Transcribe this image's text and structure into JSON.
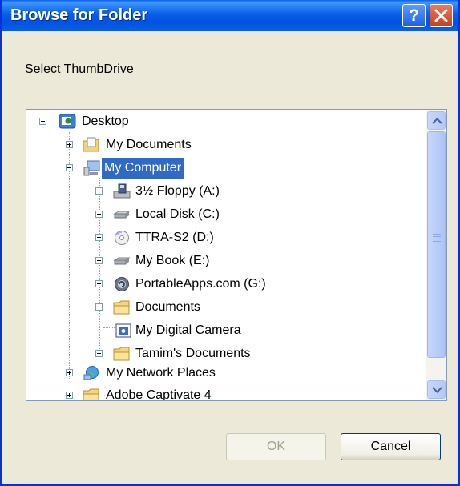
{
  "window": {
    "title": "Browse for Folder",
    "help_glyph": "?",
    "prompt": "Select ThumbDrive"
  },
  "tree": {
    "items": [
      {
        "label": "Desktop",
        "icon": "desktop-icon",
        "expander": "minus",
        "selected": false
      },
      {
        "label": "My Documents",
        "icon": "folder-documents-icon",
        "expander": "plus",
        "selected": false
      },
      {
        "label": "My Computer",
        "icon": "computer-icon",
        "expander": "minus",
        "selected": true
      },
      {
        "label": "3½ Floppy (A:)",
        "icon": "floppy-drive-icon",
        "expander": "plus",
        "selected": false
      },
      {
        "label": "Local Disk (C:)",
        "icon": "hard-disk-icon",
        "expander": "plus",
        "selected": false
      },
      {
        "label": "TTRA-S2 (D:)",
        "icon": "cd-drive-icon",
        "expander": "plus",
        "selected": false
      },
      {
        "label": "My Book (E:)",
        "icon": "hard-disk-icon",
        "expander": "plus",
        "selected": false
      },
      {
        "label": "PortableApps.com (G:)",
        "icon": "portableapps-drive-icon",
        "expander": "plus",
        "selected": false
      },
      {
        "label": "Documents",
        "icon": "folder-icon",
        "expander": "plus",
        "selected": false
      },
      {
        "label": "My Digital Camera",
        "icon": "camera-icon",
        "expander": "none",
        "selected": false
      },
      {
        "label": "Tamim's Documents",
        "icon": "folder-icon",
        "expander": "plus",
        "selected": false
      },
      {
        "label": "My Network Places",
        "icon": "network-icon",
        "expander": "plus",
        "selected": false
      },
      {
        "label": "Adobe Captivate 4",
        "icon": "folder-icon",
        "expander": "plus",
        "selected": false
      }
    ]
  },
  "buttons": {
    "ok": "OK",
    "cancel": "Cancel"
  },
  "colors": {
    "titlebar": "#0a5ee6",
    "dialog_bg": "#ece9d8",
    "selection": "#316ac5"
  }
}
